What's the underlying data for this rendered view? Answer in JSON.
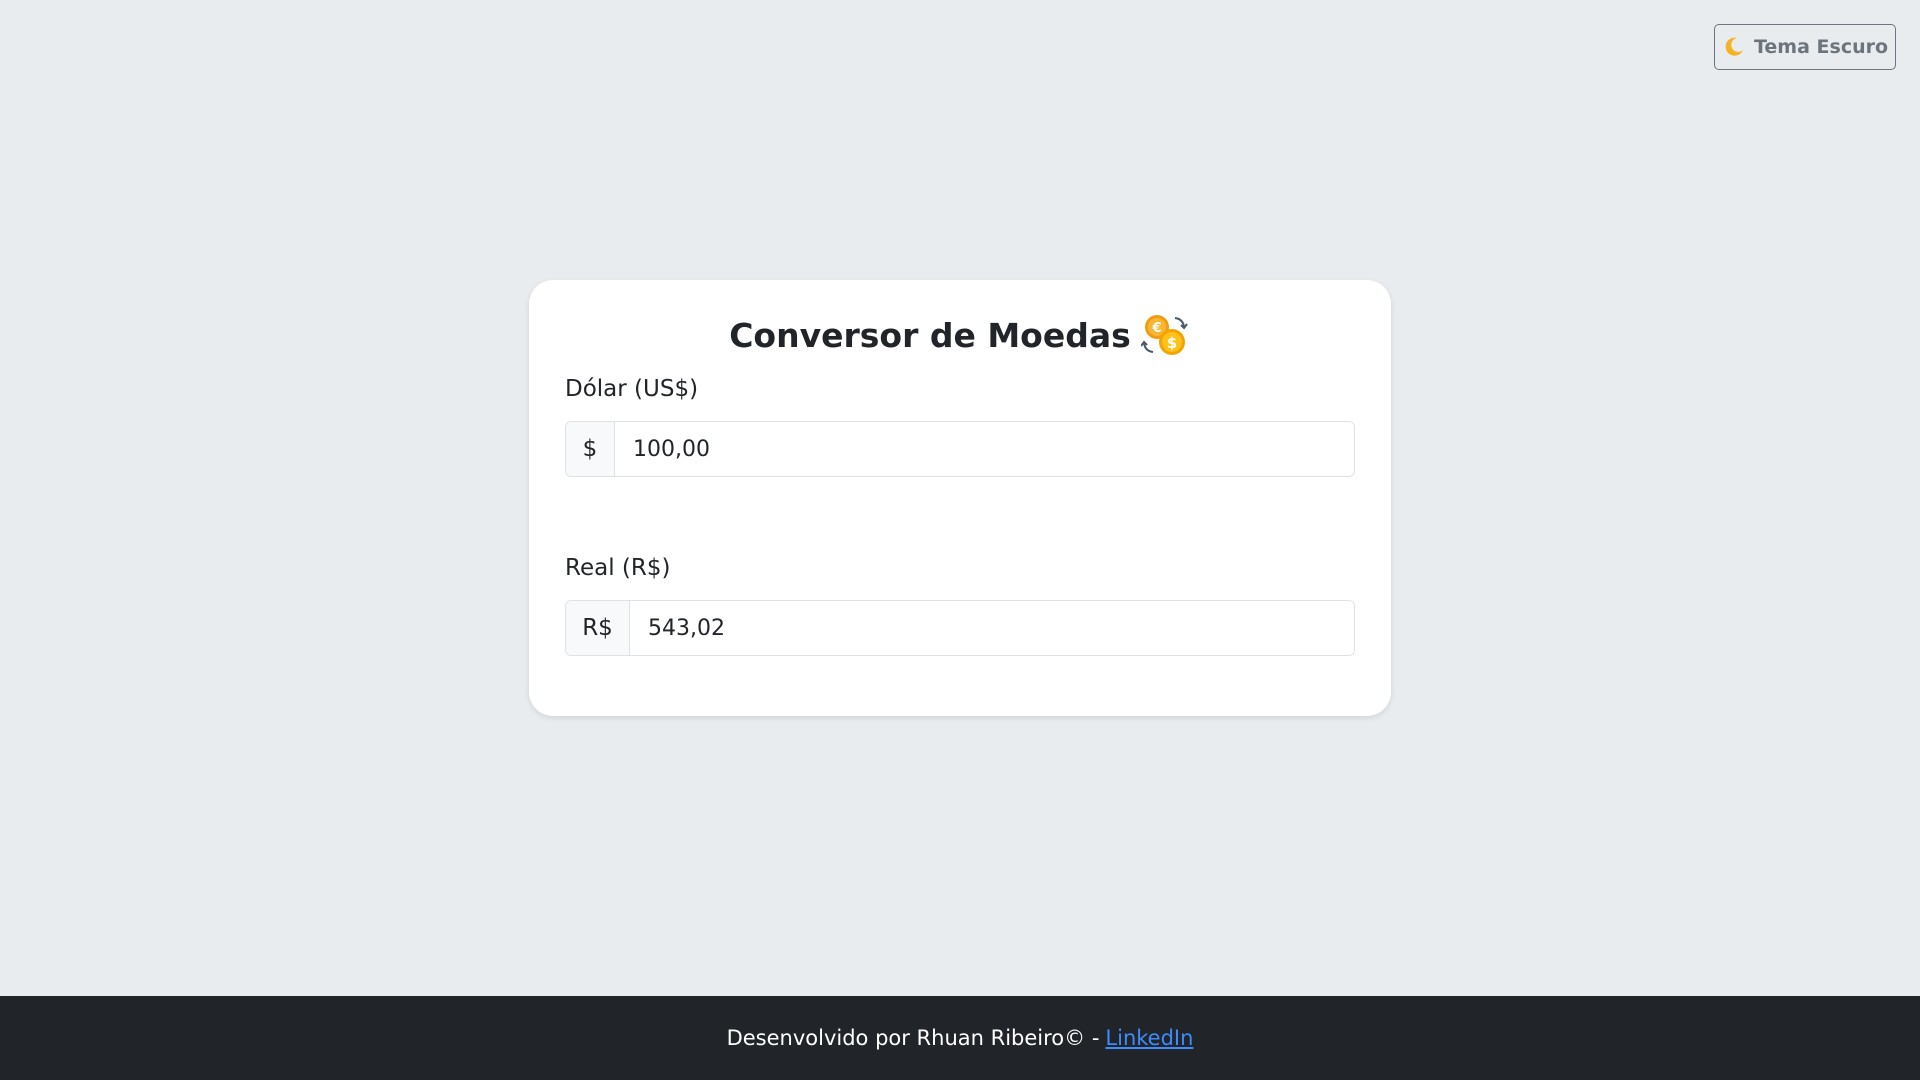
{
  "theme_toggle": {
    "icon": "moon-icon",
    "label": "Tema Escuro"
  },
  "converter": {
    "title": "Conversor de Moedas",
    "title_icon": "currency-exchange-icon",
    "dollar": {
      "label": "Dólar (US$)",
      "symbol": "$",
      "value": "100,00"
    },
    "real": {
      "label": "Real (R$)",
      "symbol": "R$",
      "value": "543,02"
    }
  },
  "footer": {
    "text": "Desenvolvido por Rhuan Ribeiro© -",
    "link_label": "LinkedIn",
    "link_color": "#3d8bfd"
  },
  "colors": {
    "background": "#e8ecef",
    "card": "#ffffff",
    "footer": "#212529"
  }
}
